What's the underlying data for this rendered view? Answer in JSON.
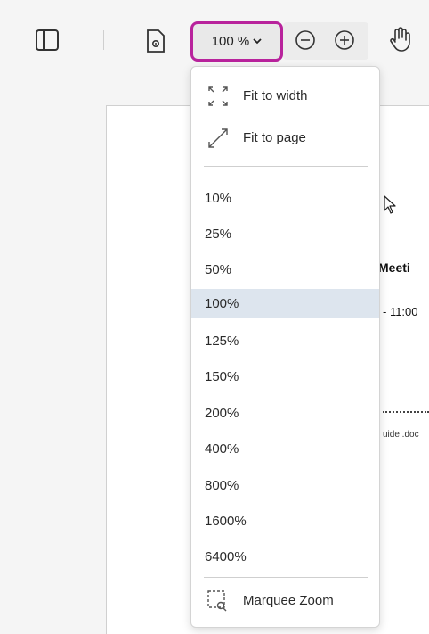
{
  "toolbar": {
    "zoom_value": "100 %",
    "icons": [
      "sidebar-toggle-icon",
      "page-settings-icon",
      "chevron-down-icon",
      "zoom-out-icon",
      "zoom-in-icon",
      "pan-hand-icon"
    ],
    "accent_color": "#b8239c"
  },
  "zoom_menu": {
    "fit_width": "Fit to width",
    "fit_page": "Fit to page",
    "levels": [
      "10%",
      "25%",
      "50%",
      "100%",
      "125%",
      "150%",
      "200%",
      "400%",
      "800%",
      "1600%",
      "6400%"
    ],
    "selected": "100%",
    "selected_color": "#dde5ee",
    "marquee": "Marquee Zoom"
  },
  "document": {
    "heading_fragment": "Meeti",
    "time_fragment": "- 11:00",
    "file_fragment": "uide .doc"
  }
}
